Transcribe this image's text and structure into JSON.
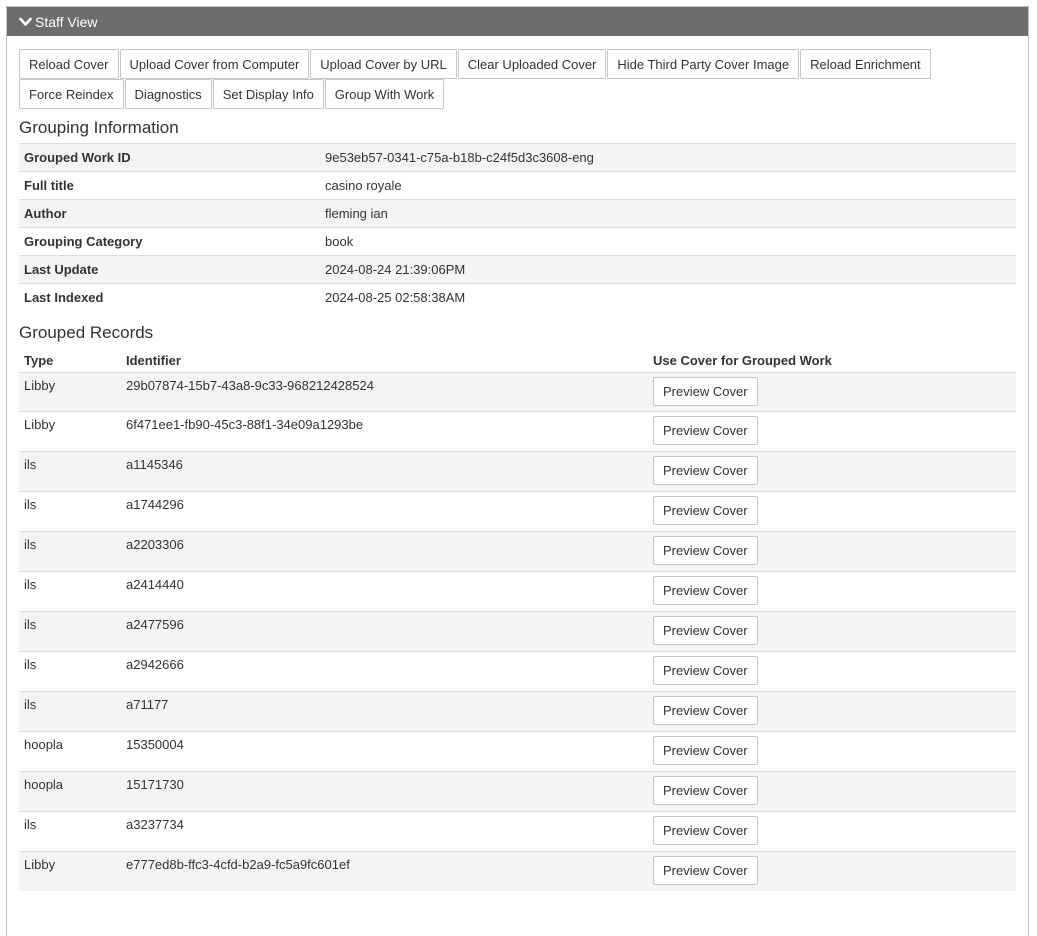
{
  "panel": {
    "title": "Staff View"
  },
  "toolbar": {
    "buttons": [
      "Reload Cover",
      "Upload Cover from Computer",
      "Upload Cover by URL",
      "Clear Uploaded Cover",
      "Hide Third Party Cover Image",
      "Reload Enrichment",
      "Force Reindex",
      "Diagnostics",
      "Set Display Info",
      "Group With Work"
    ]
  },
  "grouping": {
    "heading": "Grouping Information",
    "rows": [
      {
        "label": "Grouped Work ID",
        "value": "9e53eb57-0341-c75a-b18b-c24f5d3c3608-eng"
      },
      {
        "label": "Full title",
        "value": "casino royale"
      },
      {
        "label": "Author",
        "value": "fleming ian"
      },
      {
        "label": "Grouping Category",
        "value": "book"
      },
      {
        "label": "Last Update",
        "value": "2024-08-24 21:39:06PM"
      },
      {
        "label": "Last Indexed",
        "value": "2024-08-25 02:58:38AM"
      }
    ]
  },
  "records": {
    "heading": "Grouped Records",
    "columns": {
      "type": "Type",
      "identifier": "Identifier",
      "cover": "Use Cover for Grouped Work"
    },
    "button_label": "Preview Cover",
    "rows": [
      {
        "type": "Libby",
        "identifier": "29b07874-15b7-43a8-9c33-968212428524"
      },
      {
        "type": "Libby",
        "identifier": "6f471ee1-fb90-45c3-88f1-34e09a1293be"
      },
      {
        "type": "ils",
        "identifier": "a1145346"
      },
      {
        "type": "ils",
        "identifier": "a1744296"
      },
      {
        "type": "ils",
        "identifier": "a2203306"
      },
      {
        "type": "ils",
        "identifier": "a2414440"
      },
      {
        "type": "ils",
        "identifier": "a2477596"
      },
      {
        "type": "ils",
        "identifier": "a2942666"
      },
      {
        "type": "ils",
        "identifier": "a71177"
      },
      {
        "type": "hoopla",
        "identifier": "15350004"
      },
      {
        "type": "hoopla",
        "identifier": "15171730"
      },
      {
        "type": "ils",
        "identifier": "a3237734"
      },
      {
        "type": "Libby",
        "identifier": "e777ed8b-ffc3-4cfd-b2a9-fc5a9fc601ef"
      }
    ]
  }
}
